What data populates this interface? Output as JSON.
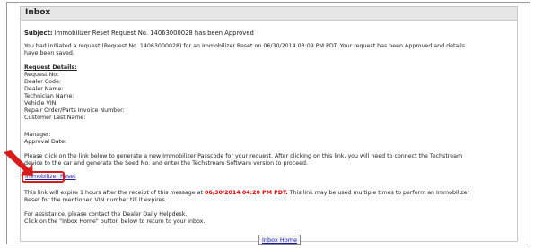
{
  "inbox": {
    "title": "Inbox"
  },
  "message": {
    "subject_label": "Subject:",
    "subject_text": "Immobilizer Reset Request No. 14063000028 has been Approved",
    "intro_line1": "You had initiated a request (Request No. 14063000028) for an Immobilizer Reset on 06/30/2014 03:09 PM PDT. Your request has been Approved and details",
    "intro_line2": "have been saved.",
    "details_heading": "Request Details:",
    "fields": [
      "Request No:",
      "Dealer Code:",
      "Dealer Name:",
      "Technician Name:",
      "Vehicle VIN:",
      "Repair Order/Parts Invoice Number:",
      "Customer Last Name:"
    ],
    "fields2": [
      "Manager:",
      "Approval Date:"
    ],
    "instruction_line1": "Please click on the link below to generate a new Immobilizer Passcode for your request. After clicking on this link, you will need to connect the Techstream",
    "instruction_line2": "device to the car and generate the Seed No. and enter the Techstream Software version to proceed.",
    "reset_link": "Immobilizer Reset",
    "expire_part1": "This link will expire 1 hours after the receipt of this message at",
    "expire_date": "06/30/2014 04:20 PM PDT.",
    "expire_part2": "This link may be used multiple times to perform an Immobilizer",
    "expire_line2": "Reset for the mentioned VIN number till it expires.",
    "assist_line1": "For assistance, please contact the Dealer Daily Helpdesk.",
    "assist_line2": "Click on the \"Inbox Home\" button below to return to your inbox.",
    "home_button": "Inbox Home"
  },
  "colors": {
    "highlight": "#d61c1c",
    "expire_red": "#d40000",
    "link": "#1a1aaa"
  }
}
